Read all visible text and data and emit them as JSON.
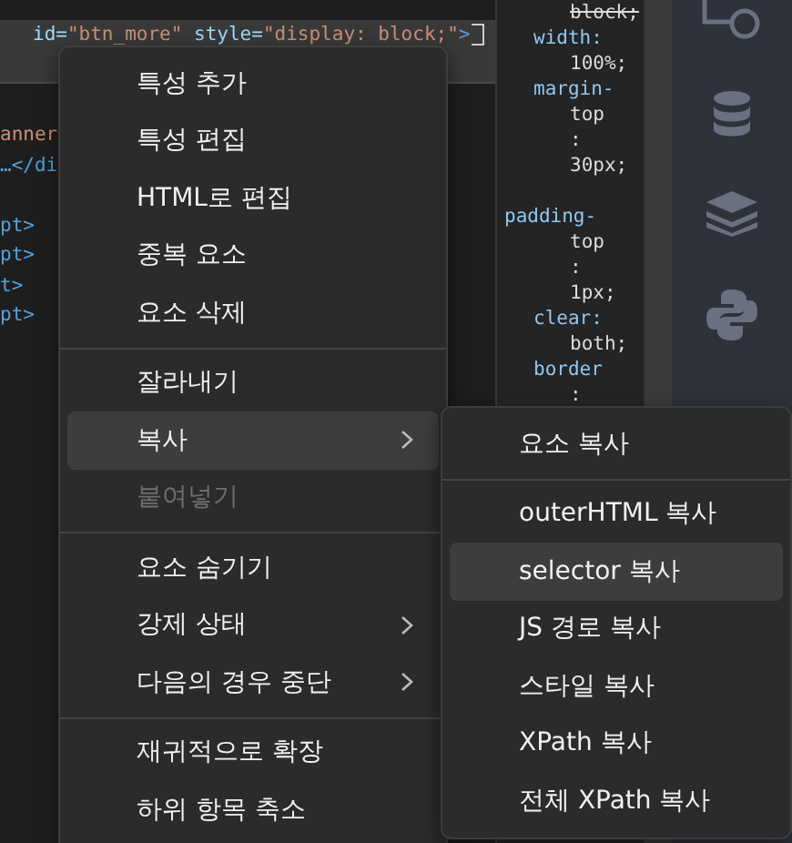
{
  "elements_panel": {
    "selected_line": {
      "attr1": "id=",
      "val1": "\"btn_more\"",
      "attr2": " style=",
      "val2": "\"display: block;\"",
      "end": ">"
    },
    "lines": [
      {
        "kind": "string",
        "text": "anner"
      },
      {
        "kind": "tag",
        "text": "…</di"
      },
      {
        "kind": "blank"
      },
      {
        "kind": "tag",
        "text": "pt>"
      },
      {
        "kind": "tag",
        "text": "pt>"
      },
      {
        "kind": "tag",
        "text": "t>"
      },
      {
        "kind": "tag",
        "text": "pt>"
      }
    ]
  },
  "styles_panel": {
    "lines": [
      {
        "kind": "value",
        "text": "block;",
        "struck": true
      },
      {
        "kind": "prop",
        "text": "width:"
      },
      {
        "kind": "value",
        "text": "100%;"
      },
      {
        "kind": "prop",
        "text": "margin-"
      },
      {
        "kind": "value",
        "text": "top"
      },
      {
        "kind": "value",
        "text": ":"
      },
      {
        "kind": "value",
        "text": "30px;"
      },
      {
        "kind": "blank"
      },
      {
        "kind": "outdent",
        "text": "padding-"
      },
      {
        "kind": "value",
        "text": "top"
      },
      {
        "kind": "value",
        "text": ":"
      },
      {
        "kind": "value",
        "text": "1px;"
      },
      {
        "kind": "prop",
        "text": "clear:"
      },
      {
        "kind": "value",
        "text": "both;"
      },
      {
        "kind": "prop",
        "text": "border"
      },
      {
        "kind": "value",
        "text": ":"
      }
    ]
  },
  "context_menu": {
    "items": [
      {
        "kind": "item",
        "label": "특성 추가",
        "selected": false,
        "disabled": false,
        "has_submenu": false
      },
      {
        "kind": "item",
        "label": "특성 편집",
        "selected": false,
        "disabled": false,
        "has_submenu": false
      },
      {
        "kind": "item",
        "label": "HTML로 편집",
        "selected": false,
        "disabled": false,
        "has_submenu": false
      },
      {
        "kind": "item",
        "label": "중복 요소",
        "selected": false,
        "disabled": false,
        "has_submenu": false
      },
      {
        "kind": "item",
        "label": "요소 삭제",
        "selected": false,
        "disabled": false,
        "has_submenu": false
      },
      {
        "kind": "separator"
      },
      {
        "kind": "item",
        "label": "잘라내기",
        "selected": false,
        "disabled": false,
        "has_submenu": false
      },
      {
        "kind": "item",
        "label": "복사",
        "selected": true,
        "disabled": false,
        "has_submenu": true
      },
      {
        "kind": "item",
        "label": "붙여넣기",
        "selected": false,
        "disabled": true,
        "has_submenu": false
      },
      {
        "kind": "separator"
      },
      {
        "kind": "item",
        "label": "요소 숨기기",
        "selected": false,
        "disabled": false,
        "has_submenu": false
      },
      {
        "kind": "item",
        "label": "강제 상태",
        "selected": false,
        "disabled": false,
        "has_submenu": true
      },
      {
        "kind": "item",
        "label": "다음의 경우 중단",
        "selected": false,
        "disabled": false,
        "has_submenu": true
      },
      {
        "kind": "separator"
      },
      {
        "kind": "item",
        "label": "재귀적으로 확장",
        "selected": false,
        "disabled": false,
        "has_submenu": false
      },
      {
        "kind": "item",
        "label": "하위 항목 축소",
        "selected": false,
        "disabled": false,
        "has_submenu": false
      }
    ]
  },
  "copy_submenu": {
    "items": [
      {
        "kind": "item",
        "label": "요소 복사",
        "selected": false,
        "disabled": false,
        "has_submenu": false
      },
      {
        "kind": "separator"
      },
      {
        "kind": "item",
        "label": "outerHTML 복사",
        "selected": false,
        "disabled": false,
        "has_submenu": false
      },
      {
        "kind": "item",
        "label": "selector 복사",
        "selected": true,
        "disabled": false,
        "has_submenu": false
      },
      {
        "kind": "item",
        "label": "JS 경로 복사",
        "selected": false,
        "disabled": false,
        "has_submenu": false
      },
      {
        "kind": "item",
        "label": "스타일 복사",
        "selected": false,
        "disabled": false,
        "has_submenu": false
      },
      {
        "kind": "item",
        "label": "XPath 복사",
        "selected": false,
        "disabled": false,
        "has_submenu": false
      },
      {
        "kind": "item",
        "label": "전체 XPath 복사",
        "selected": false,
        "disabled": false,
        "has_submenu": false
      }
    ]
  }
}
